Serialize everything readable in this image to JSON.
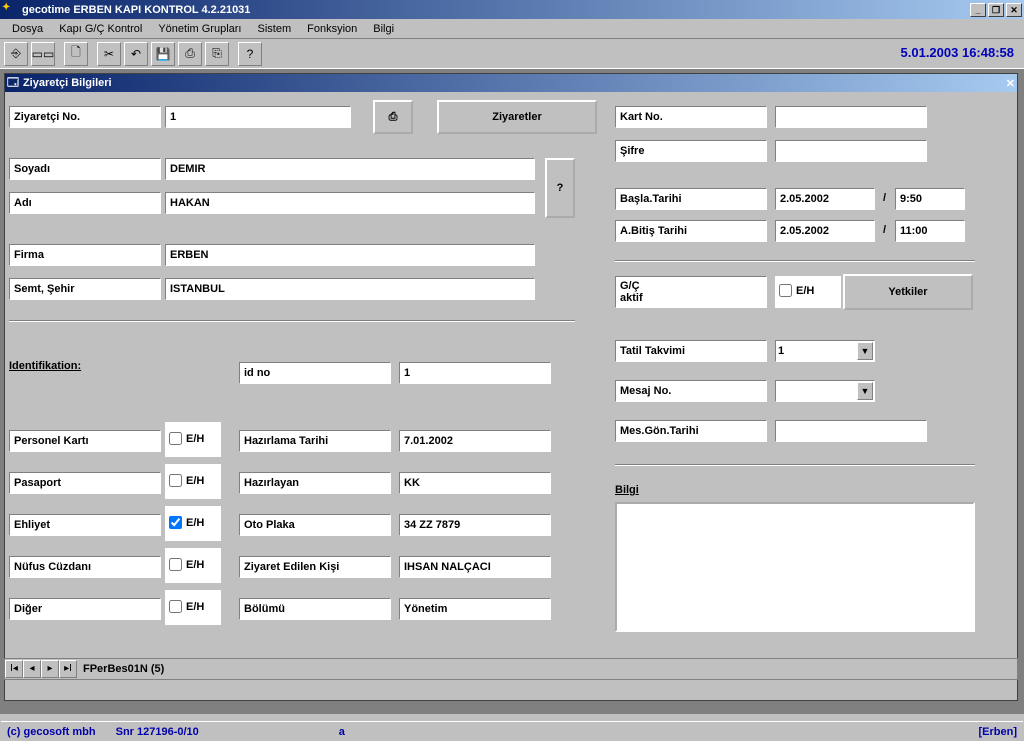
{
  "window": {
    "title": "gecotime  ERBEN KAPI  KONTROL  4.2.21031"
  },
  "menu": [
    "Dosya",
    "Kapı G/Ç Kontrol",
    "Yönetim Grupları",
    "Sistem",
    "Fonksyion",
    "Bilgi"
  ],
  "datetime": "5.01.2003  16:48:58",
  "child": {
    "title": "Ziyaretçi Bilgileri"
  },
  "labels": {
    "ziyaretci_no": "Ziyaretçi No.",
    "soyadi": "Soyadı",
    "adi": "Adı",
    "firma": "Firma",
    "semt": "Semt, Şehir",
    "identifikation": "Identifikation:",
    "idno": "id no",
    "personel": "Personel Kartı",
    "pasaport": "Pasaport",
    "ehliyet": "Ehliyet",
    "nufus": "Nüfus Cüzdanı",
    "diger": "Diğer",
    "hazirlama": "Hazırlama Tarihi",
    "hazirlayan": "Hazırlayan",
    "oto": "Oto Plaka",
    "ziyaret_edilen": "Ziyaret Edilen Kişi",
    "bolumu": "Bölümü",
    "kartno": "Kart No.",
    "sifre": "Şifre",
    "basla": "Başla.Tarihi",
    "bitis": "A.Bitiş Tarihi",
    "gc_aktif": "G/Ç\naktif",
    "tatil": "Tatil Takvimi",
    "mesajno": "Mesaj No.",
    "mesgon": "Mes.Gön.Tarihi",
    "bilgi": "Bilgi",
    "eh": "E/H"
  },
  "values": {
    "ziyaretci_no": "1",
    "soyadi": "DEMIR",
    "adi": "HAKAN",
    "firma": "ERBEN",
    "semt": "ISTANBUL",
    "idno_val": "1",
    "hazirlama": "7.01.2002",
    "hazirlayan": "KK",
    "oto": "34 ZZ 7879",
    "ziyaret_edilen": "IHSAN NALÇACI",
    "bolumu": "Yönetim",
    "basla_date": "2.05.2002",
    "basla_time": "9:50",
    "bitis_date": "2.05.2002",
    "bitis_time": "11:00",
    "tatil": "1",
    "slash": "/"
  },
  "buttons": {
    "ziyaretler": "Ziyaretler",
    "yetkiler": "Yetkiler",
    "question": "?"
  },
  "nav": {
    "label": "FPerBes01N  (5)"
  },
  "status": {
    "copyright": "(c) gecosoft mbh",
    "snr": "Snr 127196-0/10",
    "a": "a",
    "erben": "[Erben]"
  },
  "checkboxes": {
    "personel": false,
    "pasaport": false,
    "ehliyet": true,
    "nufus": false,
    "diger": false,
    "gc_eh": false
  }
}
